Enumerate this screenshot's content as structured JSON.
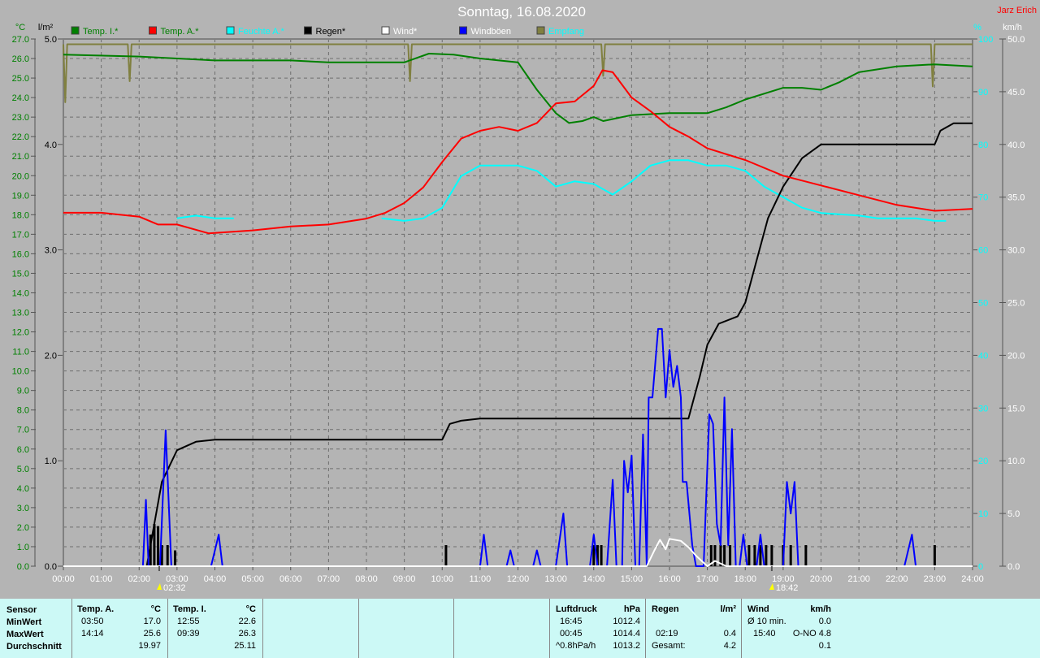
{
  "header": {
    "title": "Sonntag, 16.08.2020",
    "author": "Jarz Erich"
  },
  "legend": [
    {
      "label": "Temp. I.*",
      "color": "#008000",
      "text_color": "#008000"
    },
    {
      "label": "Temp. A.*",
      "color": "#ff0000",
      "text_color": "#008000"
    },
    {
      "label": "Feuchte A.*",
      "color": "#00ffff",
      "text_color": "#00ffff"
    },
    {
      "label": "Regen*",
      "color": "#000000",
      "text_color": "#000000"
    },
    {
      "label": "Wind*",
      "color": "#ffffff",
      "text_color": "#ffffff"
    },
    {
      "label": "Windböen",
      "color": "#0000ff",
      "text_color": "#ffffff"
    },
    {
      "label": "Empfang",
      "color": "#808040",
      "text_color": "#00ffff"
    }
  ],
  "chart_data": {
    "type": "line",
    "title": "Sonntag, 16.08.2020",
    "x_unit": "hour",
    "xlim": [
      0,
      24
    ],
    "x_ticks": [
      "00:00",
      "01:00",
      "02:00",
      "03:00",
      "04:00",
      "05:00",
      "06:00",
      "07:00",
      "08:00",
      "09:00",
      "10:00",
      "11:00",
      "12:00",
      "13:00",
      "14:00",
      "15:00",
      "16:00",
      "17:00",
      "18:00",
      "19:00",
      "20:00",
      "21:00",
      "22:00",
      "23:00",
      "24:00"
    ],
    "axes": {
      "temp": {
        "unit": "°C",
        "ylim": [
          0,
          27
        ],
        "ticks": [
          "0.0",
          "1.0",
          "2.0",
          "3.0",
          "4.0",
          "5.0",
          "6.0",
          "7.0",
          "8.0",
          "9.0",
          "10.0",
          "11.0",
          "12.0",
          "13.0",
          "14.0",
          "15.0",
          "16.0",
          "17.0",
          "18.0",
          "19.0",
          "20.0",
          "21.0",
          "22.0",
          "23.0",
          "24.0",
          "25.0",
          "26.0",
          "27.0"
        ]
      },
      "rain": {
        "unit": "l/m²",
        "ylim": [
          0,
          5
        ],
        "ticks": [
          "0.0",
          "1.0",
          "2.0",
          "3.0",
          "4.0",
          "5.0"
        ]
      },
      "humidity": {
        "unit": "%",
        "ylim": [
          0,
          100
        ],
        "ticks": [
          "0",
          "10",
          "20",
          "30",
          "40",
          "50",
          "60",
          "70",
          "80",
          "90",
          "100"
        ]
      },
      "wind": {
        "unit": "km/h",
        "ylim": [
          0,
          50
        ],
        "ticks": [
          "0.0",
          "5.0",
          "10.0",
          "15.0",
          "20.0",
          "25.0",
          "30.0",
          "35.0",
          "40.0",
          "45.0",
          "50.0"
        ]
      }
    },
    "series": [
      {
        "name": "Temp. I.*",
        "axis": "temp",
        "color": "#008000",
        "points": [
          [
            0,
            26.2
          ],
          [
            2,
            26.1
          ],
          [
            4,
            25.9
          ],
          [
            6,
            25.9
          ],
          [
            7,
            25.8
          ],
          [
            9,
            25.8
          ],
          [
            9.65,
            26.25
          ],
          [
            10.3,
            26.2
          ],
          [
            11,
            26.0
          ],
          [
            12,
            25.8
          ],
          [
            12.5,
            24.4
          ],
          [
            13,
            23.2
          ],
          [
            13.35,
            22.7
          ],
          [
            13.7,
            22.8
          ],
          [
            14,
            23.0
          ],
          [
            14.25,
            22.8
          ],
          [
            15,
            23.1
          ],
          [
            16,
            23.2
          ],
          [
            17,
            23.2
          ],
          [
            17.5,
            23.5
          ],
          [
            18,
            23.9
          ],
          [
            19,
            24.5
          ],
          [
            19.5,
            24.5
          ],
          [
            20,
            24.4
          ],
          [
            20.5,
            24.8
          ],
          [
            21,
            25.3
          ],
          [
            22,
            25.6
          ],
          [
            23,
            25.7
          ],
          [
            24,
            25.6
          ]
        ]
      },
      {
        "name": "Temp. A.*",
        "axis": "temp",
        "color": "#ff0000",
        "points": [
          [
            0,
            18.1
          ],
          [
            1,
            18.1
          ],
          [
            2,
            17.9
          ],
          [
            2.5,
            17.5
          ],
          [
            3,
            17.5
          ],
          [
            3.83,
            17.05
          ],
          [
            5,
            17.2
          ],
          [
            6,
            17.4
          ],
          [
            7,
            17.5
          ],
          [
            8,
            17.8
          ],
          [
            8.5,
            18.1
          ],
          [
            9,
            18.6
          ],
          [
            9.5,
            19.4
          ],
          [
            10,
            20.7
          ],
          [
            10.5,
            21.9
          ],
          [
            11,
            22.3
          ],
          [
            11.5,
            22.5
          ],
          [
            12,
            22.3
          ],
          [
            12.5,
            22.7
          ],
          [
            13,
            23.7
          ],
          [
            13.5,
            23.8
          ],
          [
            14,
            24.6
          ],
          [
            14.23,
            25.4
          ],
          [
            14.5,
            25.3
          ],
          [
            15,
            24.0
          ],
          [
            15.5,
            23.3
          ],
          [
            16,
            22.5
          ],
          [
            16.5,
            22.0
          ],
          [
            17,
            21.4
          ],
          [
            18,
            20.8
          ],
          [
            19,
            20.0
          ],
          [
            20,
            19.5
          ],
          [
            21,
            19.0
          ],
          [
            22,
            18.5
          ],
          [
            23,
            18.2
          ],
          [
            24,
            18.3
          ]
        ]
      },
      {
        "name": "Feuchte A.*",
        "axis": "humidity",
        "color": "#00ffff",
        "segments": [
          [
            [
              3,
              66
            ],
            [
              3.5,
              66.5
            ],
            [
              4,
              66
            ],
            [
              4.5,
              66
            ]
          ],
          [
            [
              8.4,
              66
            ],
            [
              9,
              65.5
            ],
            [
              9.5,
              66
            ],
            [
              10,
              68
            ],
            [
              10.5,
              74
            ],
            [
              11,
              76
            ],
            [
              12,
              76
            ],
            [
              12.5,
              75
            ],
            [
              13,
              72
            ],
            [
              13.5,
              73
            ],
            [
              14,
              72.5
            ],
            [
              14.5,
              70.5
            ],
            [
              15,
              73
            ],
            [
              15.5,
              76
            ],
            [
              16,
              77
            ],
            [
              16.5,
              77
            ],
            [
              17,
              76
            ],
            [
              17.5,
              76
            ],
            [
              18,
              75
            ],
            [
              18.5,
              72
            ],
            [
              19,
              70
            ],
            [
              19.5,
              68
            ],
            [
              20,
              67
            ],
            [
              21,
              66.5
            ],
            [
              21.5,
              66
            ],
            [
              22.5,
              66
            ],
            [
              23,
              65.5
            ],
            [
              23.3,
              65.5
            ]
          ]
        ]
      },
      {
        "name": "Regen*",
        "axis": "rain",
        "color": "#000000",
        "points": [
          [
            0,
            0
          ],
          [
            2.2,
            0
          ],
          [
            2.4,
            0.4
          ],
          [
            2.6,
            0.8
          ],
          [
            3,
            1.1
          ],
          [
            3.5,
            1.18
          ],
          [
            4,
            1.2
          ],
          [
            10,
            1.2
          ],
          [
            10.2,
            1.35
          ],
          [
            10.5,
            1.38
          ],
          [
            11,
            1.4
          ],
          [
            16.5,
            1.4
          ],
          [
            16.8,
            1.8
          ],
          [
            17,
            2.1
          ],
          [
            17.3,
            2.3
          ],
          [
            17.8,
            2.37
          ],
          [
            18,
            2.5
          ],
          [
            18.3,
            2.9
          ],
          [
            18.6,
            3.3
          ],
          [
            19,
            3.6
          ],
          [
            19.5,
            3.87
          ],
          [
            20,
            4.0
          ],
          [
            23,
            4.0
          ],
          [
            23.15,
            4.13
          ],
          [
            23.5,
            4.2
          ],
          [
            24,
            4.2
          ]
        ]
      },
      {
        "name": "Wind*",
        "axis": "wind",
        "color": "#ffffff",
        "points": [
          [
            0,
            0
          ],
          [
            15.4,
            0
          ],
          [
            15.6,
            1.5
          ],
          [
            15.75,
            2.5
          ],
          [
            15.9,
            1.6
          ],
          [
            16,
            2.6
          ],
          [
            16.3,
            2.4
          ],
          [
            16.5,
            1.8
          ],
          [
            16.7,
            1
          ],
          [
            17,
            0
          ],
          [
            17.2,
            0.5
          ],
          [
            17.5,
            0
          ],
          [
            24,
            0
          ]
        ]
      },
      {
        "name": "Windböen",
        "axis": "wind",
        "color": "#0000ff",
        "points": [
          [
            0,
            0
          ],
          [
            2.1,
            0
          ],
          [
            2.18,
            6.3
          ],
          [
            2.25,
            0
          ],
          [
            2.55,
            0
          ],
          [
            2.7,
            12.9
          ],
          [
            2.85,
            0
          ],
          [
            3.9,
            0
          ],
          [
            4.1,
            3
          ],
          [
            4.2,
            0
          ],
          [
            11,
            0
          ],
          [
            11.1,
            3
          ],
          [
            11.2,
            0
          ],
          [
            11.7,
            0
          ],
          [
            11.8,
            1.5
          ],
          [
            11.9,
            0
          ],
          [
            12.4,
            0
          ],
          [
            12.5,
            1.5
          ],
          [
            12.6,
            0
          ],
          [
            13,
            0
          ],
          [
            13.2,
            5
          ],
          [
            13.3,
            0
          ],
          [
            13.9,
            0
          ],
          [
            14,
            3
          ],
          [
            14.1,
            0
          ],
          [
            14.35,
            0
          ],
          [
            14.5,
            8.2
          ],
          [
            14.6,
            0
          ],
          [
            14.75,
            0
          ],
          [
            14.8,
            10
          ],
          [
            14.9,
            7
          ],
          [
            15,
            10.5
          ],
          [
            15.1,
            0
          ],
          [
            15.2,
            0
          ],
          [
            15.3,
            12.5
          ],
          [
            15.4,
            0
          ],
          [
            15.45,
            16
          ],
          [
            15.55,
            16
          ],
          [
            15.7,
            22.5
          ],
          [
            15.8,
            22.5
          ],
          [
            15.9,
            16
          ],
          [
            16,
            20.5
          ],
          [
            16.1,
            17
          ],
          [
            16.2,
            19
          ],
          [
            16.3,
            16
          ],
          [
            16.35,
            8
          ],
          [
            16.45,
            8
          ],
          [
            16.6,
            2
          ],
          [
            16.7,
            0
          ],
          [
            16.9,
            0
          ],
          [
            17.05,
            14.4
          ],
          [
            17.15,
            13.5
          ],
          [
            17.25,
            4
          ],
          [
            17.35,
            2
          ],
          [
            17.45,
            16
          ],
          [
            17.55,
            2
          ],
          [
            17.65,
            13
          ],
          [
            17.75,
            0
          ],
          [
            17.85,
            0
          ],
          [
            17.95,
            3
          ],
          [
            18.05,
            0
          ],
          [
            18.3,
            0
          ],
          [
            18.4,
            3
          ],
          [
            18.5,
            0
          ],
          [
            19.0,
            0
          ],
          [
            19.1,
            8
          ],
          [
            19.2,
            5
          ],
          [
            19.3,
            8
          ],
          [
            19.4,
            0
          ],
          [
            22.2,
            0
          ],
          [
            22.4,
            3
          ],
          [
            22.5,
            0
          ],
          [
            24,
            0
          ]
        ]
      },
      {
        "name": "Empfang",
        "axis": "humidity",
        "color": "#808040",
        "points": [
          [
            0,
            99
          ],
          [
            0.05,
            88
          ],
          [
            0.1,
            99
          ],
          [
            1.7,
            99
          ],
          [
            1.75,
            92
          ],
          [
            1.8,
            99
          ],
          [
            9.1,
            99
          ],
          [
            9.15,
            92
          ],
          [
            9.2,
            99
          ],
          [
            14.2,
            99
          ],
          [
            14.25,
            93
          ],
          [
            14.3,
            99
          ],
          [
            22.9,
            99
          ],
          [
            22.95,
            91
          ],
          [
            23,
            99
          ],
          [
            24,
            99
          ]
        ]
      }
    ],
    "rain_bars": {
      "axis": "rain",
      "color": "#000000",
      "bars": [
        [
          2.3,
          0.3
        ],
        [
          2.4,
          0.4
        ],
        [
          2.5,
          0.38
        ],
        [
          2.6,
          0.2
        ],
        [
          2.75,
          0.2
        ],
        [
          2.95,
          0.15
        ],
        [
          10.1,
          0.2
        ],
        [
          14.0,
          0.2
        ],
        [
          14.1,
          0.2
        ],
        [
          14.2,
          0.2
        ],
        [
          17.1,
          0.2
        ],
        [
          17.2,
          0.2
        ],
        [
          17.35,
          0.2
        ],
        [
          17.45,
          0.2
        ],
        [
          17.6,
          0.2
        ],
        [
          18.1,
          0.2
        ],
        [
          18.25,
          0.2
        ],
        [
          18.4,
          0.2
        ],
        [
          18.55,
          0.2
        ],
        [
          18.7,
          0.2
        ],
        [
          19.0,
          0.2
        ],
        [
          19.2,
          0.2
        ],
        [
          19.6,
          0.2
        ],
        [
          23.0,
          0.2
        ]
      ]
    },
    "annotations": [
      {
        "label": "02:32",
        "x": 2.53,
        "type": "sunrise"
      },
      {
        "label": "18:42",
        "x": 18.7,
        "type": "sunset"
      }
    ]
  },
  "table": {
    "temp_a": {
      "sensor": "Sensor",
      "min": "MinWert",
      "max": "MaxWert",
      "avg": "Durchschnitt",
      "title": "Temp. A.",
      "unit": "°C",
      "min_time": "03:50",
      "min_val": "17.0",
      "max_time": "14:14",
      "max_val": "25.6",
      "avg_val": "19.97"
    },
    "temp_i": {
      "title": "Temp. I.",
      "unit": "°C",
      "min_time": "12:55",
      "min_val": "22.6",
      "max_time": "09:39",
      "max_val": "26.3",
      "avg_val": "25.11"
    },
    "pressure": {
      "title": "Luftdruck",
      "unit": "hPa",
      "min_time": "16:45",
      "min_val": "1012.4",
      "max_time": "00:45",
      "max_val": "1014.4",
      "trend": "^0.8hPa/h",
      "avg_val": "1013.2"
    },
    "rain": {
      "title": "Regen",
      "unit": "l/m²",
      "max_time": "02:19",
      "max_val": "0.4",
      "total_label": "Gesamt:",
      "total_val": "4.2"
    },
    "wind": {
      "title": "Wind",
      "unit": "km/h",
      "avg10_label": "Ø 10 min.",
      "avg10_val": "0.0",
      "max_time": "15:40",
      "max_val": "O-NO 4.8",
      "avg_val": "0.1"
    }
  }
}
